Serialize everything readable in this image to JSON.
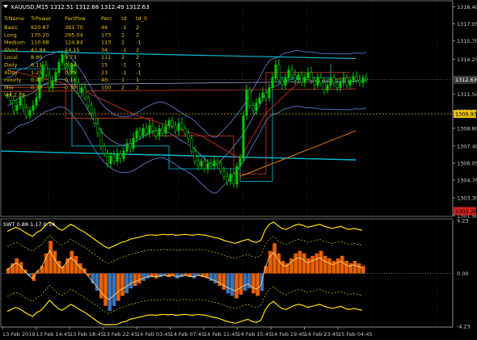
{
  "window": {
    "title": "XAUUSD,M15  1312.51 1312.68 1312.49 1312.63"
  },
  "colors": {
    "background": "#000000",
    "grid": "#2a2a2a",
    "axis": "#8c8c8c",
    "bull": "#00c800",
    "bear": "#00c800",
    "table_text": "#e6c000",
    "price_label_bg": "#d21e1e",
    "level_label_bg": "#e6c000",
    "cyan": "#00bcd4",
    "blue_band": "#4f6fb5",
    "red_line": "#c83c1e",
    "orange_line": "#e67a00",
    "yellow": "#ffe000",
    "swt_bull": "#ff6a00",
    "swt_blue": "#3f7fcf"
  },
  "table": {
    "headers": [
      "TrName",
      "TrPower",
      "PartPow",
      "Perc",
      "td",
      "td_0"
    ],
    "rows": [
      [
        "Basic",
        "820.87",
        "381.70",
        "46",
        "-1",
        "2"
      ],
      [
        "Long",
        "170.20",
        "295.04",
        "173",
        "2",
        "2"
      ],
      [
        "Medium",
        "110.68",
        "124.84",
        "113",
        "2",
        "-1"
      ],
      [
        "Short",
        "41.84",
        "14.15",
        "34",
        "-1",
        "2"
      ],
      [
        "Local",
        "8.80",
        "9.73",
        "111",
        "2",
        "2"
      ],
      [
        "Daily",
        "6.11",
        "0.94",
        "15",
        "-1",
        "-1"
      ],
      [
        "4Day",
        "1.25",
        "0.29",
        "23",
        "-1",
        "-1"
      ],
      [
        "Hourly",
        "0.40",
        "0.16",
        "40",
        "1",
        "1"
      ],
      [
        "Min",
        "0.30",
        "0.30",
        "100",
        "2",
        "2"
      ]
    ],
    "footer": "Vol:2.26"
  },
  "price_axis": {
    "ticks": [
      "1318.40",
      "1317.05",
      "1315.70",
      "1314.25",
      "1312.80",
      "1311.50",
      "1310.15",
      "1308.80",
      "1307.40",
      "1306.05",
      "1304.70",
      "1303.30",
      "1301.90"
    ],
    "current_price_label": "1312.63",
    "level_label": "1309.93",
    "low_label": "1302.26"
  },
  "swt_panel": {
    "title": "SWT 0.88 1.17 0.14",
    "ticks": [
      "4.23",
      "0.00",
      "-4.23"
    ]
  },
  "time_axis": {
    "labels": [
      "13 Feb 2019",
      "13 Feb 14:45",
      "13 Feb 18:45",
      "13 Feb 22:45",
      "14 Feb 03:45",
      "14 Feb 07:45",
      "14 Feb 11:45",
      "14 Feb 15:45",
      "14 Feb 19:45",
      "14 Feb 23:45",
      "15 Feb 04:45"
    ]
  },
  "chart_data": [
    {
      "type": "candlestick",
      "title": "XAUUSD,M15",
      "ylim": [
        1301.9,
        1318.8
      ],
      "close_series": [
        1311.4,
        1311.0,
        1310.2,
        1310.6,
        1311.2,
        1310.4,
        1309.8,
        1310.2,
        1310.6,
        1311.2,
        1312.8,
        1313.8,
        1313.0,
        1312.0,
        1312.5,
        1313.2,
        1314.0,
        1314.6,
        1313.6,
        1313.2,
        1313.8,
        1312.4,
        1311.6,
        1312.0,
        1311.2,
        1310.6,
        1310.0,
        1309.2,
        1308.4,
        1307.4,
        1306.8,
        1306.0,
        1306.6,
        1306.2,
        1306.8,
        1306.4,
        1307.0,
        1307.6,
        1307.2,
        1308.0,
        1308.6,
        1308.2,
        1308.8,
        1308.4,
        1309.0,
        1308.6,
        1308.2,
        1308.8,
        1308.4,
        1309.0,
        1309.4,
        1309.0,
        1308.6,
        1309.2,
        1308.8,
        1308.4,
        1308.0,
        1307.0,
        1306.2,
        1305.8,
        1306.2,
        1305.6,
        1306.0,
        1305.8,
        1306.2,
        1306.0,
        1305.4,
        1305.0,
        1304.6,
        1305.2,
        1304.4,
        1305.8,
        1306.4,
        1309.8,
        1311.8,
        1310.6,
        1310.2,
        1310.8,
        1311.2,
        1311.6,
        1311.2,
        1312.0,
        1312.8,
        1313.8,
        1312.6,
        1312.2,
        1312.8,
        1313.4,
        1313.0,
        1312.6,
        1313.0,
        1312.4,
        1312.8,
        1313.2,
        1312.6,
        1312.2,
        1312.8,
        1312.4,
        1311.8,
        1312.2,
        1312.8,
        1312.4,
        1312.0,
        1312.4,
        1312.8,
        1312.2,
        1312.6,
        1312.9,
        1312.6,
        1312.4,
        1312.8,
        1312.63
      ],
      "current_price": 1312.63,
      "levels": [
        1309.93,
        1302.26
      ]
    },
    {
      "type": "histogram",
      "title": "SWT 0.88 1.17 0.14",
      "ylim": [
        -4.23,
        4.23
      ],
      "values": [
        0.4,
        0.8,
        1.2,
        0.9,
        0.3,
        -0.2,
        -0.6,
        0.2,
        0.6,
        1.6,
        2.6,
        1.8,
        1.0,
        0.6,
        1.2,
        1.8,
        1.4,
        0.8,
        0.4,
        -0.2,
        -0.8,
        -1.4,
        -2.0,
        -2.6,
        -3.0,
        -2.6,
        -2.2,
        -1.8,
        -1.6,
        -1.2,
        -1.0,
        -0.8,
        -0.6,
        -0.4,
        -0.3,
        -0.4,
        -0.3,
        -0.2,
        -0.3,
        -0.2,
        -0.4,
        -0.3,
        -0.2,
        -0.3,
        -0.4,
        -0.2,
        -0.3,
        -0.4,
        -0.6,
        -0.8,
        -1.0,
        -1.3,
        -1.6,
        -1.8,
        -2.0,
        -1.7,
        -1.4,
        -1.2,
        -1.6,
        -1.8,
        -1.4,
        0.6,
        1.8,
        2.4,
        1.6,
        1.0,
        0.8,
        1.2,
        1.6,
        1.8,
        1.6,
        1.2,
        1.4,
        1.6,
        1.8,
        1.4,
        1.2,
        1.0,
        1.2,
        1.4,
        1.0,
        0.8,
        1.0,
        0.8,
        0.6
      ],
      "zero_line": 0.0
    }
  ]
}
